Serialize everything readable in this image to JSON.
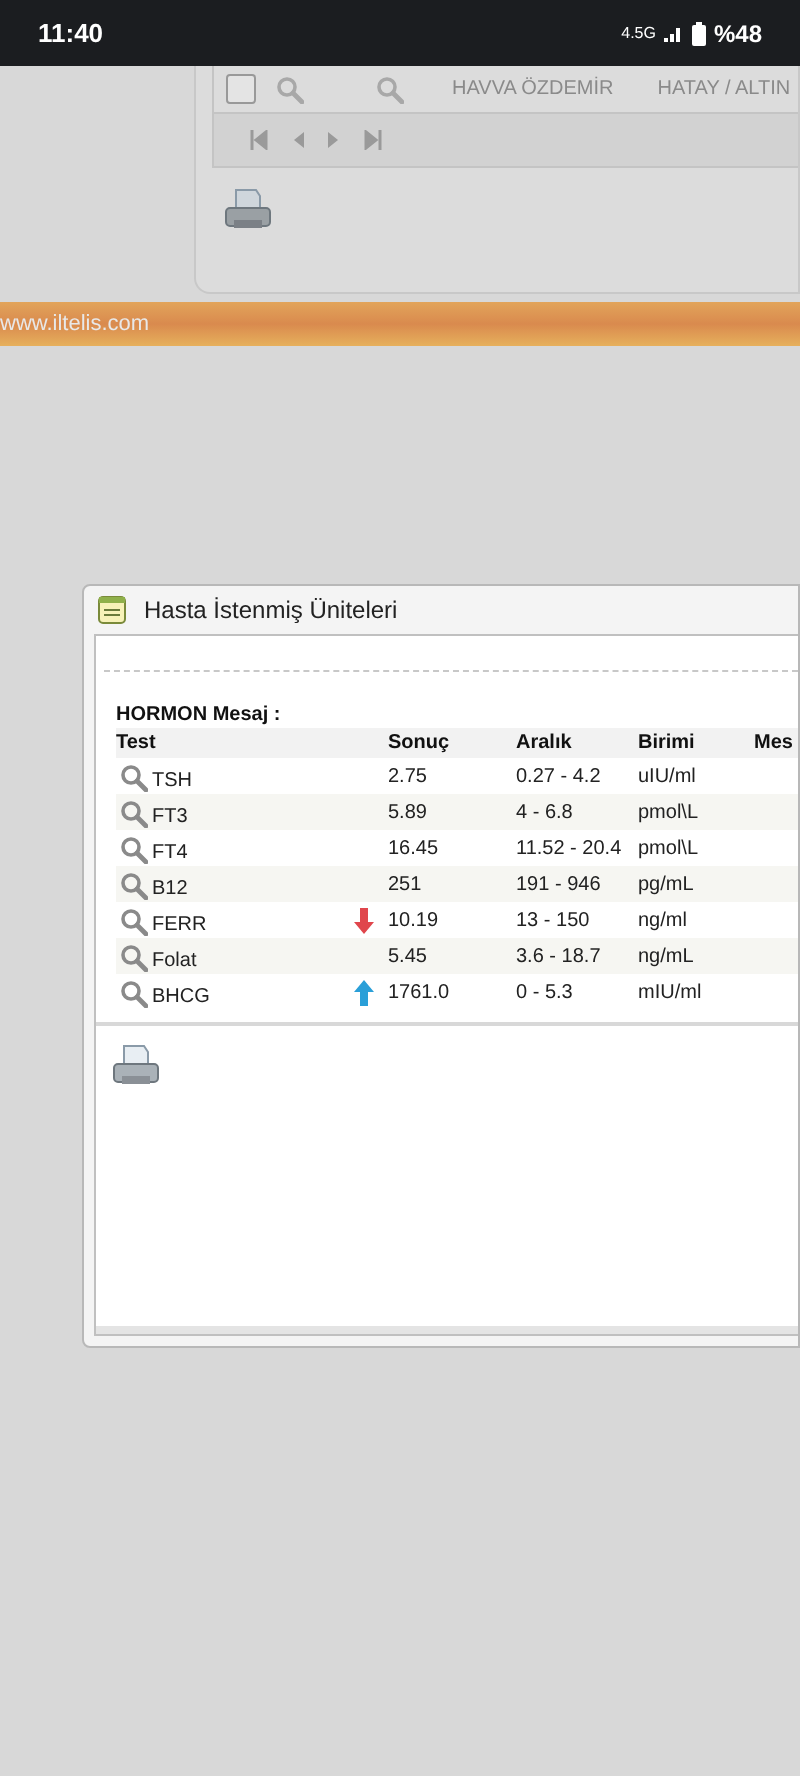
{
  "status_bar": {
    "time": "11:40",
    "network": "4.5G",
    "battery": "%48"
  },
  "background_panel": {
    "row": [
      "HAVVA ÖZDEMİR",
      "HATAY / ALTIN"
    ],
    "checked": false
  },
  "footer_banner": {
    "text": "www.iltelis.com"
  },
  "dialog": {
    "title": "Hasta İstenmiş Üniteleri",
    "section": "HORMON Mesaj :",
    "columns": [
      "Test",
      "Sonuç",
      "Aralık",
      "Birimi",
      "Mes"
    ],
    "rows": [
      {
        "test": "TSH",
        "kind": "none",
        "result": "2.75",
        "range": "0.27 - 4.2",
        "unit": "uIU/ml"
      },
      {
        "test": "FT3",
        "kind": "none",
        "result": "5.89",
        "range": "4 - 6.8",
        "unit": "pmol\\L"
      },
      {
        "test": "FT4",
        "kind": "none",
        "result": "16.45",
        "range": "11.52 - 20.4",
        "unit": "pmol\\L"
      },
      {
        "test": "B12",
        "kind": "none",
        "result": "251",
        "range": "191 - 946",
        "unit": "pg/mL"
      },
      {
        "test": "FERR",
        "kind": "low",
        "result": "10.19",
        "range": "13 - 150",
        "unit": "ng/ml"
      },
      {
        "test": "Folat",
        "kind": "none",
        "result": "5.45",
        "range": "3.6 - 18.7",
        "unit": "ng/mL"
      },
      {
        "test": "BHCG",
        "kind": "high",
        "result": "1761.0",
        "range": "0 - 5.3",
        "unit": "mIU/ml"
      }
    ]
  }
}
